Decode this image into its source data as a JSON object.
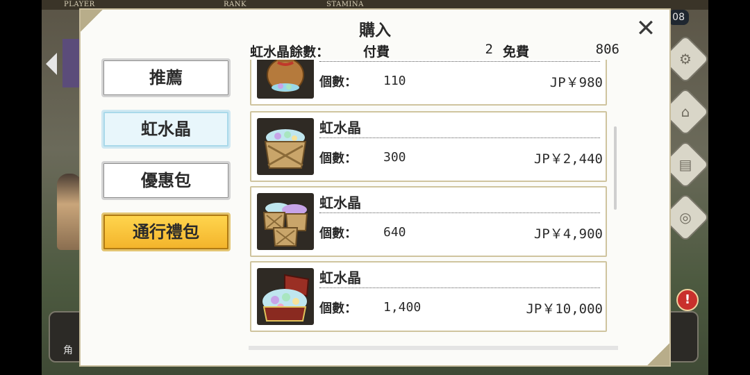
{
  "background": {
    "labels": [
      "PLAYER",
      "RANK",
      "STAMINA"
    ],
    "counter": "08",
    "bottom_left_label": "角"
  },
  "dialog": {
    "title": "購入",
    "close_icon": "close-icon",
    "balance": {
      "label": "虹水晶餘數：",
      "paid_label": "付費",
      "paid_value": "2",
      "free_label": "免費",
      "free_value": "806"
    },
    "tabs": [
      {
        "label": "推薦",
        "state": "normal"
      },
      {
        "label": "虹水晶",
        "state": "selected"
      },
      {
        "label": "優惠包",
        "state": "normal"
      },
      {
        "label": "通行禮包",
        "state": "highlight"
      }
    ],
    "items": [
      {
        "name": "",
        "qty_label": "個數：",
        "qty": "110",
        "price": "JP￥980",
        "icon": "crystal-bag-icon"
      },
      {
        "name": "虹水晶",
        "qty_label": "個數：",
        "qty": "300",
        "price": "JP￥2,440",
        "icon": "crystal-crate-icon"
      },
      {
        "name": "虹水晶",
        "qty_label": "個數：",
        "qty": "640",
        "price": "JP￥4,900",
        "icon": "crystal-crates-icon"
      },
      {
        "name": "虹水晶",
        "qty_label": "個數：",
        "qty": "1,400",
        "price": "JP￥10,000",
        "icon": "crystal-chest-icon"
      }
    ]
  },
  "colors": {
    "panel_border": "#c8bd9c",
    "item_border": "#cfc49e",
    "tab_gold": "#f3b32a",
    "tab_selected": "#e8f6fb"
  }
}
